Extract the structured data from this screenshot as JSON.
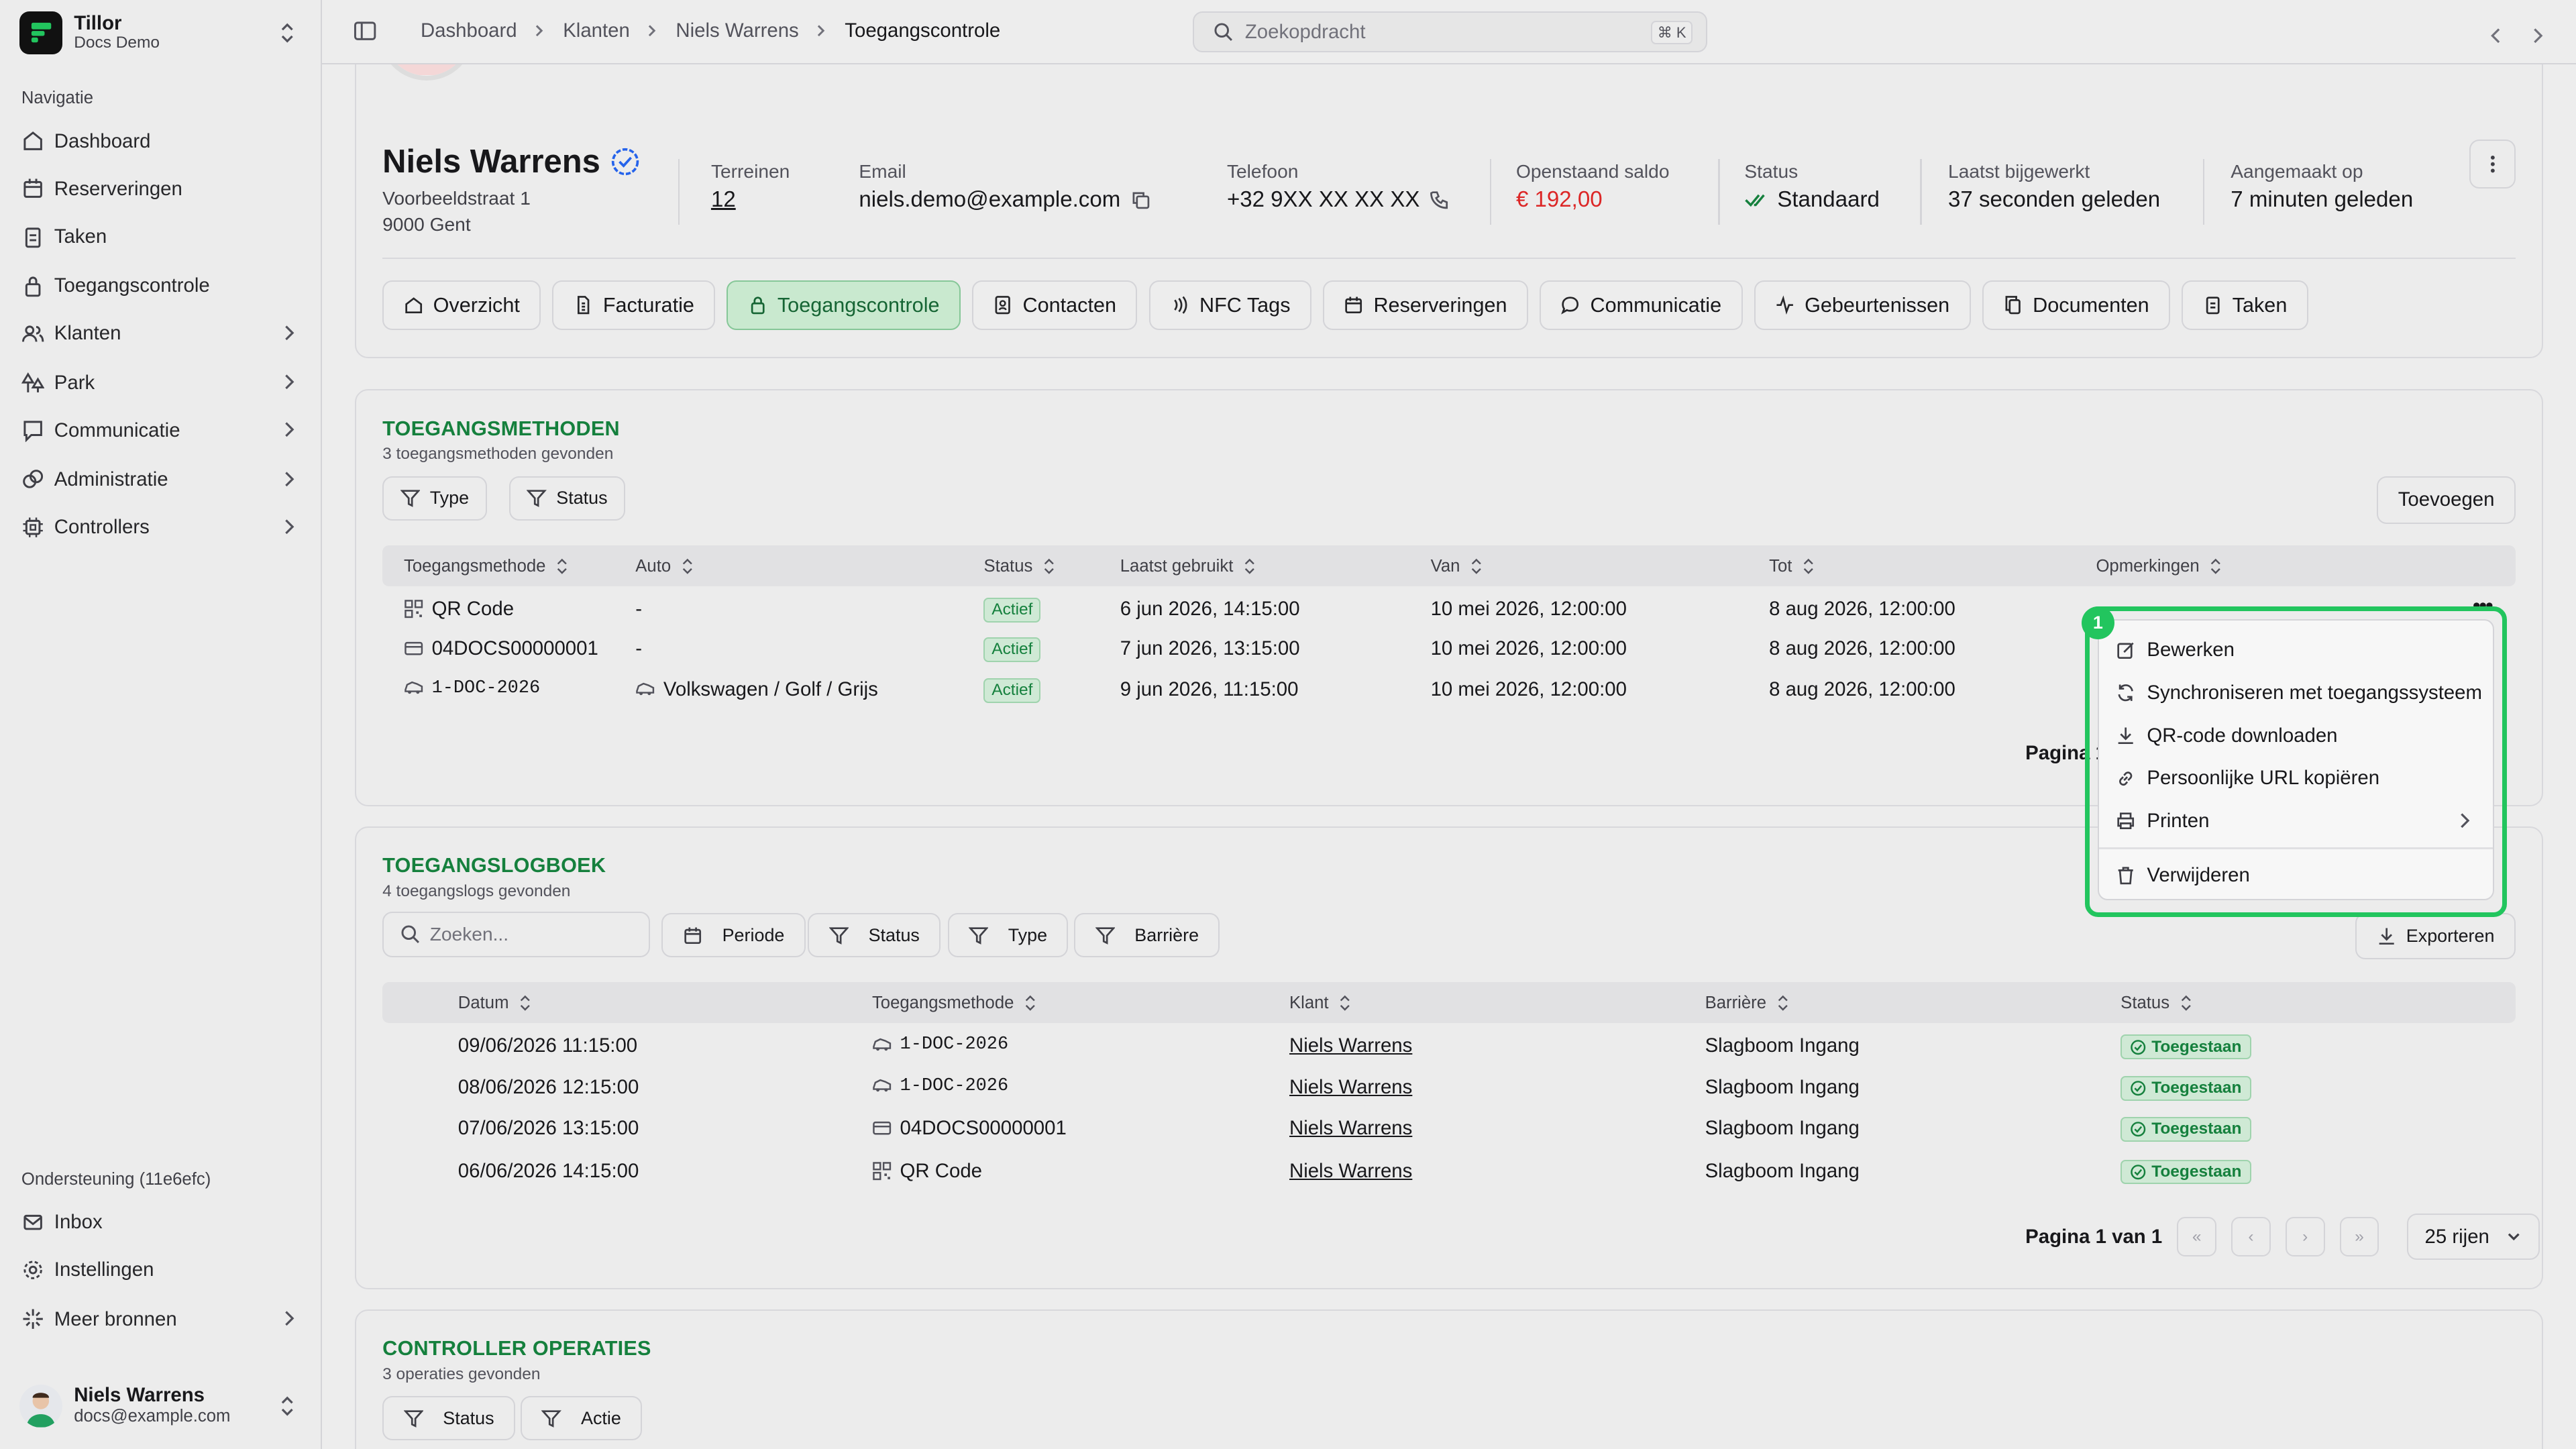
{
  "app": {
    "name": "Tillor",
    "workspace": "Docs Demo"
  },
  "sidebar": {
    "nav_label": "Navigatie",
    "items": [
      {
        "label": "Dashboard",
        "icon": "home-icon"
      },
      {
        "label": "Reserveringen",
        "icon": "calendar-icon"
      },
      {
        "label": "Taken",
        "icon": "clipboard-icon"
      },
      {
        "label": "Toegangscontrole",
        "icon": "lock-icon"
      },
      {
        "label": "Klanten",
        "icon": "users-icon"
      },
      {
        "label": "Park",
        "icon": "park-icon"
      },
      {
        "label": "Communicatie",
        "icon": "message-icon"
      },
      {
        "label": "Administratie",
        "icon": "coins-icon"
      },
      {
        "label": "Controllers",
        "icon": "cpu-icon"
      }
    ],
    "support_label": "Ondersteuning (11e6efc)",
    "support_items": [
      {
        "label": "Inbox",
        "icon": "mail-icon"
      },
      {
        "label": "Instellingen",
        "icon": "gear-icon"
      },
      {
        "label": "Meer bronnen",
        "icon": "sparkle-icon"
      }
    ],
    "user": {
      "name": "Niels Warrens",
      "email": "docs@example.com"
    }
  },
  "topbar": {
    "breadcrumbs": [
      "Dashboard",
      "Klanten",
      "Niels Warrens",
      "Toegangscontrole"
    ],
    "search_placeholder": "Zoekopdracht",
    "search_kbd": "⌘ K"
  },
  "profile": {
    "name": "Niels Warrens",
    "address_line1": "Voorbeeldstraat 1",
    "address_line2": "9000 Gent",
    "stats": {
      "terreinen": {
        "label": "Terreinen",
        "value": "12"
      },
      "email": {
        "label": "Email",
        "value": "niels.demo@example.com"
      },
      "telefoon": {
        "label": "Telefoon",
        "value": "+32 9XX XX XX XX"
      },
      "saldo": {
        "label": "Openstaand saldo",
        "value": "€ 192,00"
      },
      "status": {
        "label": "Status",
        "value": "Standaard"
      },
      "bijgewerkt": {
        "label": "Laatst bijgewerkt",
        "value": "37 seconden geleden"
      },
      "aangemaakt": {
        "label": "Aangemaakt op",
        "value": "7 minuten geleden"
      }
    },
    "tabs": [
      "Overzicht",
      "Facturatie",
      "Toegangscontrole",
      "Contacten",
      "NFC Tags",
      "Reserveringen",
      "Communicatie",
      "Gebeurtenissen",
      "Documenten",
      "Taken"
    ]
  },
  "methods": {
    "title": "TOEGANGSMETHODEN",
    "subtitle": "3 toegangsmethoden gevonden",
    "filters": [
      "Type",
      "Status"
    ],
    "add_label": "Toevoegen",
    "columns": [
      "Toegangsmethode",
      "Auto",
      "Status",
      "Laatst gebruikt",
      "Van",
      "Tot",
      "Opmerkingen"
    ],
    "rows": [
      {
        "method": "QR Code",
        "auto": "-",
        "status": "Actief",
        "last_used": "6 jun 2026, 14:15:00",
        "from": "10 mei 2026, 12:00:00",
        "to": "8 aug 2026, 12:00:00"
      },
      {
        "method": "04DOCS00000001",
        "auto": "-",
        "status": "Actief",
        "last_used": "7 jun 2026, 13:15:00",
        "from": "10 mei 2026, 12:00:00",
        "to": "8 aug 2026, 12:00:00"
      },
      {
        "method": "1-DOC-2026",
        "auto": "Volkswagen / Golf / Grijs",
        "status": "Actief",
        "last_used": "9 jun 2026, 11:15:00",
        "from": "10 mei 2026, 12:00:00",
        "to": "8 aug 2026, 12:00:00"
      }
    ],
    "pager_partial": "Pagina 1"
  },
  "context_menu": {
    "badge": "1",
    "items": [
      "Bewerken",
      "Synchroniseren met toegangssysteem",
      "QR-code downloaden",
      "Persoonlijke URL kopiëren",
      "Printen"
    ],
    "danger_item": "Verwijderen"
  },
  "logbook": {
    "title": "TOEGANGSLOGBOEK",
    "subtitle": "4 toegangslogs gevonden",
    "search_placeholder": "Zoeken...",
    "filters": [
      "Periode",
      "Status",
      "Type",
      "Barrière"
    ],
    "export_label": "Exporteren",
    "columns": [
      "Datum",
      "Toegangsmethode",
      "Klant",
      "Barrière",
      "Status"
    ],
    "rows": [
      {
        "date": "09/06/2026 11:15:00",
        "method": "1-DOC-2026",
        "customer": "Niels Warrens",
        "barrier": "Slagboom Ingang",
        "status": "Toegestaan"
      },
      {
        "date": "08/06/2026 12:15:00",
        "method": "1-DOC-2026",
        "customer": "Niels Warrens",
        "barrier": "Slagboom Ingang",
        "status": "Toegestaan"
      },
      {
        "date": "07/06/2026 13:15:00",
        "method": "04DOCS00000001",
        "customer": "Niels Warrens",
        "barrier": "Slagboom Ingang",
        "status": "Toegestaan"
      },
      {
        "date": "06/06/2026 14:15:00",
        "method": "QR Code",
        "customer": "Niels Warrens",
        "barrier": "Slagboom Ingang",
        "status": "Toegestaan"
      }
    ],
    "pager": "Pagina 1 van 1",
    "rows_select": "25 rijen"
  },
  "controller_ops": {
    "title": "CONTROLLER OPERATIES",
    "subtitle": "3 operaties gevonden",
    "filters": [
      "Status",
      "Actie"
    ]
  },
  "colors": {
    "accent_green": "#15803d",
    "highlight": "#22c55e",
    "danger_red": "#dc2626"
  }
}
